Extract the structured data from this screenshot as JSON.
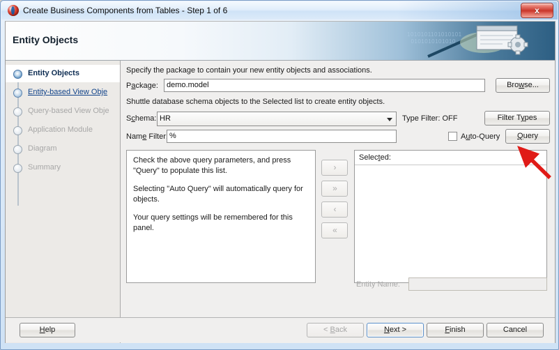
{
  "window": {
    "title": "Create Business Components from Tables - Step 1 of 6",
    "app_icon": "oracle-jdeveloper-icon",
    "close_label": "x"
  },
  "banner": {
    "title": "Entity Objects",
    "binary_art": "1010101101010101\n0101010101010",
    "icon": "document-gear-icon"
  },
  "sidebar": {
    "steps": [
      {
        "label": "Entity Objects",
        "state": "active"
      },
      {
        "label": "Entity-based View Obje",
        "state": "done"
      },
      {
        "label": "Query-based View Obje",
        "state": "todo"
      },
      {
        "label": "Application Module",
        "state": "todo"
      },
      {
        "label": "Diagram",
        "state": "todo"
      },
      {
        "label": "Summary",
        "state": "todo"
      }
    ]
  },
  "main": {
    "package_hint": "Specify the package to contain your new entity objects and associations.",
    "package_label": "Package:",
    "package_value": "demo.model",
    "browse_label": "Browse...",
    "shuttle_hint": "Shuttle database schema objects to the Selected list to create entity objects.",
    "schema_label": "Schema:",
    "schema_value": "HR",
    "type_filter_status": "Type Filter: OFF",
    "filter_types_label": "Filter Types",
    "name_filter_label": "Name Filter:",
    "name_filter_value": "%",
    "auto_query_label": "Auto-Query",
    "auto_query_checked": false,
    "query_label": "Query",
    "available_text": [
      "Check the above query parameters, and press \"Query\" to populate this list.",
      "Selecting \"Auto Query\" will automatically query for objects.",
      "Your query settings will be remembered for this panel."
    ],
    "shuttle_buttons": [
      {
        "name": "move-right",
        "glyph": "›"
      },
      {
        "name": "move-all-right",
        "glyph": "»"
      },
      {
        "name": "move-left",
        "glyph": "‹"
      },
      {
        "name": "move-all-left",
        "glyph": "«"
      }
    ],
    "selected_label": "Selected:",
    "selected_items": [],
    "entity_name_label": "Entity Name:",
    "entity_name_value": ""
  },
  "footer": {
    "help_label": "Help",
    "back_label": "< Back",
    "next_label": "Next >",
    "finish_label": "Finish",
    "cancel_label": "Cancel"
  },
  "annotation": {
    "type": "red-arrow",
    "color": "#e01b17",
    "points_to": "query-button"
  }
}
